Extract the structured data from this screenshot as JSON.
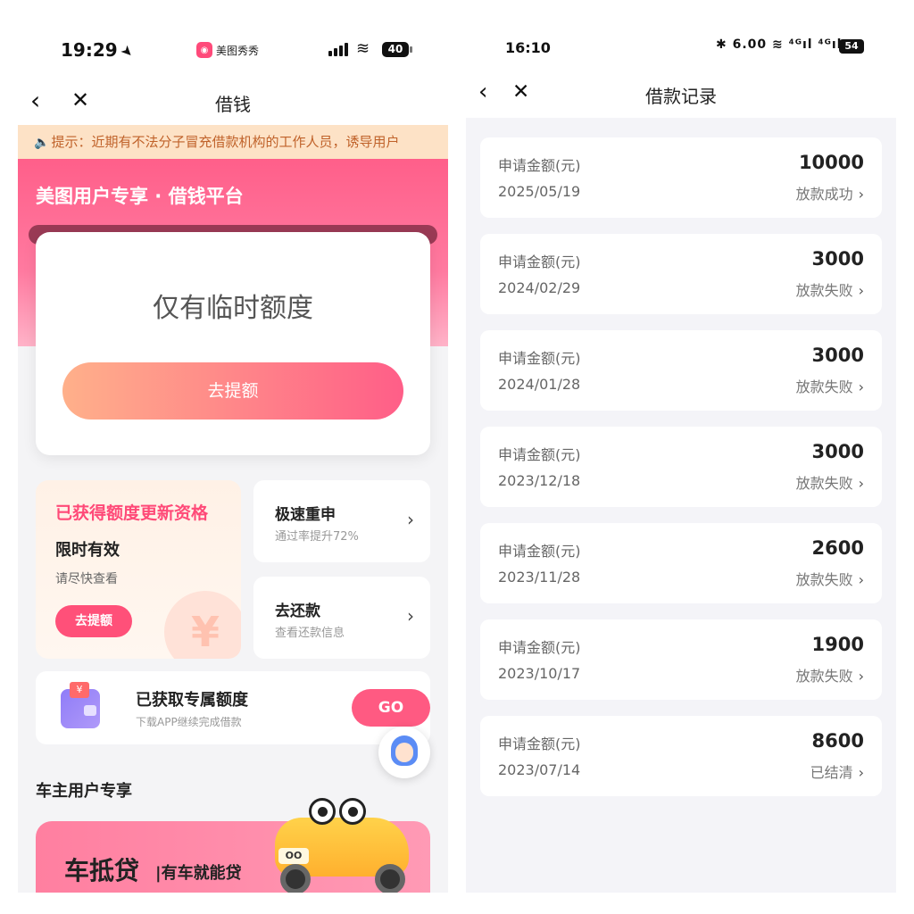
{
  "left": {
    "status": {
      "time": "19:29",
      "app_chip": "美图秀秀",
      "battery": "40"
    },
    "nav": {
      "title": "借钱"
    },
    "notice": "提示：近期有不法分子冒充借款机构的工作人员，诱导用户",
    "hero": {
      "title": "美图用户专享 · 借钱平台"
    },
    "quota_card": {
      "text": "仅有临时额度",
      "button": "去提额"
    },
    "update_card": {
      "title": "已获得额度更新资格",
      "subtitle": "限时有效",
      "desc": "请尽快查看",
      "button": "去提额",
      "yen": "¥"
    },
    "fast_reapply": {
      "title": "极速重申",
      "desc": "通过率提升72%"
    },
    "repay": {
      "title": "去还款",
      "desc": "查看还款信息"
    },
    "exclusive": {
      "title": "已获取专属额度",
      "desc": "下载APP继续完成借款",
      "button": "GO"
    },
    "car_section": {
      "title": "车主用户专享",
      "banner_main": "车抵贷",
      "banner_sub": "|有车就能贷",
      "plate": "OO"
    }
  },
  "right": {
    "status": {
      "time": "16:10",
      "indicators": "✱ 6.00 ≋ ⁴ᴳıl ⁴ᴳıl",
      "battery": "54"
    },
    "nav": {
      "title": "借款记录"
    },
    "records": [
      {
        "label": "申请金额(元)",
        "date": "2025/05/19",
        "amount": "10000",
        "status": "放款成功"
      },
      {
        "label": "申请金额(元)",
        "date": "2024/02/29",
        "amount": "3000",
        "status": "放款失败"
      },
      {
        "label": "申请金额(元)",
        "date": "2024/01/28",
        "amount": "3000",
        "status": "放款失败"
      },
      {
        "label": "申请金额(元)",
        "date": "2023/12/18",
        "amount": "3000",
        "status": "放款失败"
      },
      {
        "label": "申请金额(元)",
        "date": "2023/11/28",
        "amount": "2600",
        "status": "放款失败"
      },
      {
        "label": "申请金额(元)",
        "date": "2023/10/17",
        "amount": "1900",
        "status": "放款失败"
      },
      {
        "label": "申请金额(元)",
        "date": "2023/07/14",
        "amount": "8600",
        "status": "已结清"
      }
    ]
  }
}
